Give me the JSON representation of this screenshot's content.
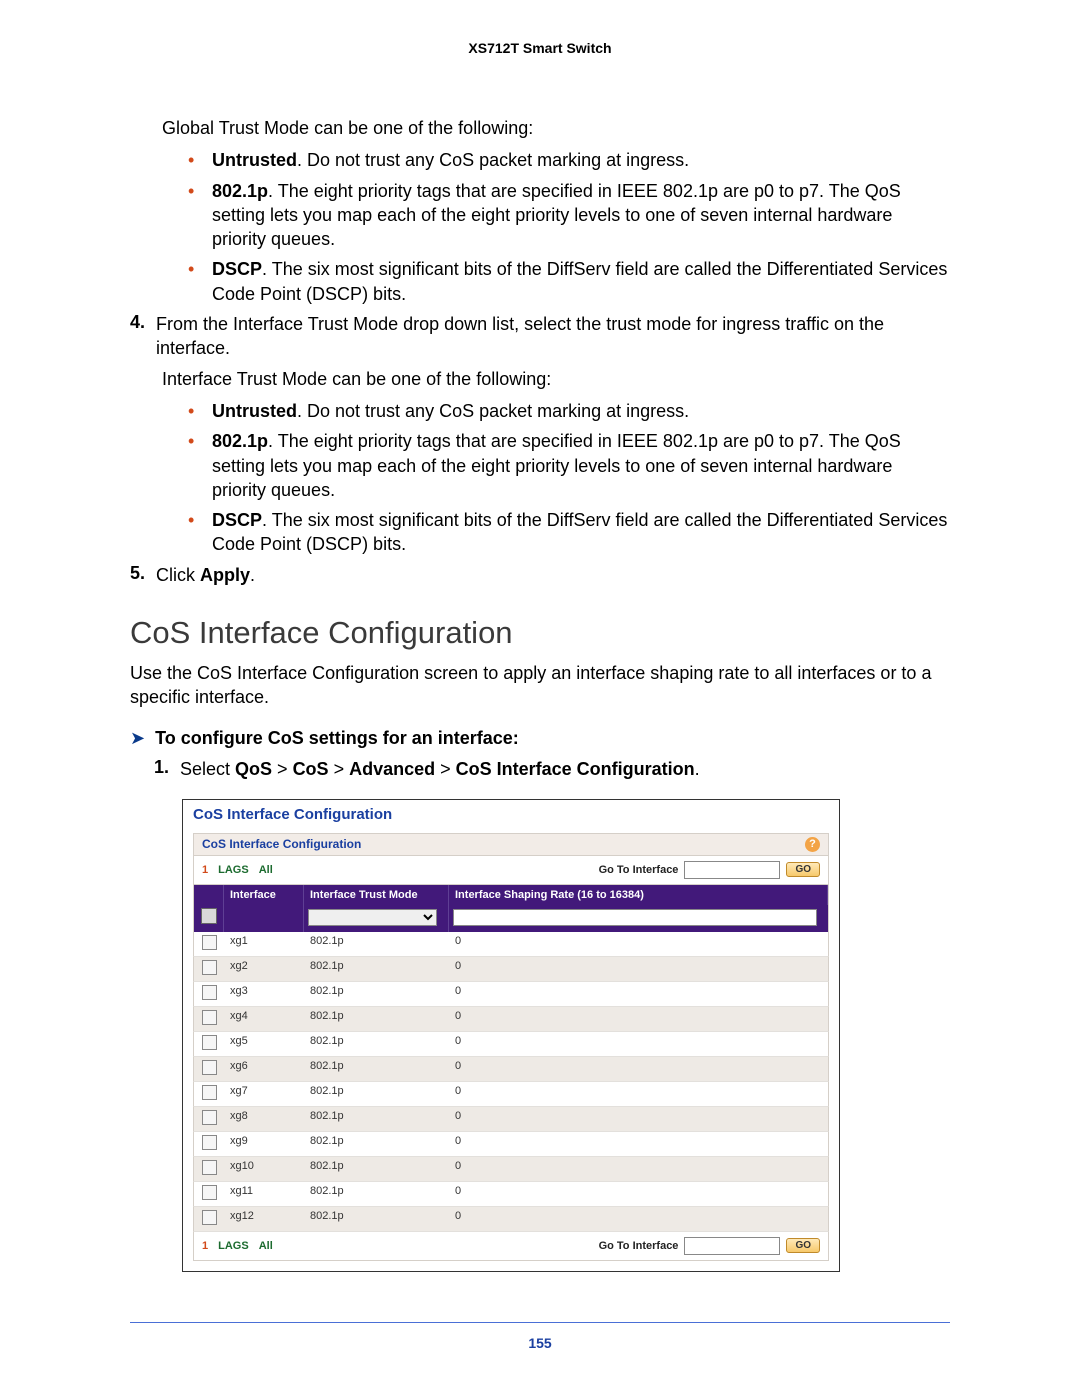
{
  "header": {
    "title": "XS712T Smart Switch"
  },
  "intro1": "Global Trust Mode can be one of the following:",
  "bullets1": [
    {
      "b": "Untrusted",
      "t": ". Do not trust any CoS packet marking at ingress."
    },
    {
      "b": "802.1p",
      "t": ". The eight priority tags that are specified in IEEE 802.1p are p0 to p7. The QoS setting lets you map each of the eight priority levels to one of seven internal hardware priority queues."
    },
    {
      "b": "DSCP",
      "t": ". The six most significant bits of the DiffServ field are called the Differentiated Services Code Point (DSCP) bits."
    }
  ],
  "step4": {
    "num": "4.",
    "text": "From the Interface Trust Mode drop down list, select the trust mode for ingress traffic on the interface.",
    "sub": "Interface Trust Mode can be one of the following:"
  },
  "bullets2": [
    {
      "b": "Untrusted",
      "t": ". Do not trust any CoS packet marking at ingress."
    },
    {
      "b": "802.1p",
      "t": ". The eight priority tags that are specified in IEEE 802.1p are p0 to p7. The QoS setting lets you map each of the eight priority levels to one of seven internal hardware priority queues."
    },
    {
      "b": "DSCP",
      "t": ". The six most significant bits of the DiffServ field are called the Differentiated Services Code Point (DSCP) bits."
    }
  ],
  "step5": {
    "num": "5.",
    "pre": "Click ",
    "b": "Apply",
    "post": "."
  },
  "section": {
    "title": "CoS Interface Configuration",
    "desc": "Use the CoS Interface Configuration screen to apply an interface shaping rate to all interfaces or to a specific interface."
  },
  "proc": {
    "arrow": "➤",
    "head": "To configure CoS settings for an interface:",
    "step1": {
      "num": "1.",
      "pre": "Select ",
      "p1": "QoS",
      "gt": " > ",
      "p2": "CoS",
      "p3": "Advanced",
      "p4": "CoS Interface Configuration",
      "post": "."
    }
  },
  "shot": {
    "title": "CoS Interface Configuration",
    "subtitle": "CoS Interface Configuration",
    "help": "?",
    "tabs": {
      "t1": "1",
      "t2": "LAGS",
      "t3": "All"
    },
    "gti_label": "Go To Interface",
    "go": "GO",
    "headers": {
      "if": "Interface",
      "tm": "Interface Trust Mode",
      "sr": "Interface Shaping Rate (16 to 16384)"
    },
    "rows": [
      {
        "if": "xg1",
        "tm": "802.1p",
        "sr": "0"
      },
      {
        "if": "xg2",
        "tm": "802.1p",
        "sr": "0"
      },
      {
        "if": "xg3",
        "tm": "802.1p",
        "sr": "0"
      },
      {
        "if": "xg4",
        "tm": "802.1p",
        "sr": "0"
      },
      {
        "if": "xg5",
        "tm": "802.1p",
        "sr": "0"
      },
      {
        "if": "xg6",
        "tm": "802.1p",
        "sr": "0"
      },
      {
        "if": "xg7",
        "tm": "802.1p",
        "sr": "0"
      },
      {
        "if": "xg8",
        "tm": "802.1p",
        "sr": "0"
      },
      {
        "if": "xg9",
        "tm": "802.1p",
        "sr": "0"
      },
      {
        "if": "xg10",
        "tm": "802.1p",
        "sr": "0"
      },
      {
        "if": "xg11",
        "tm": "802.1p",
        "sr": "0"
      },
      {
        "if": "xg12",
        "tm": "802.1p",
        "sr": "0"
      }
    ]
  },
  "page_number": "155"
}
